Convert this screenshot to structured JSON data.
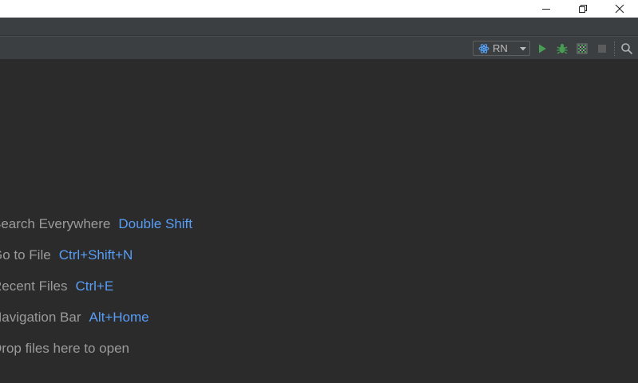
{
  "toolbar": {
    "run_config": {
      "label": "RN",
      "icon": "react-atom-icon"
    },
    "icons": {
      "run": "run-icon",
      "debug": "debug-icon",
      "coverage": "coverage-icon",
      "stop": "stop-icon",
      "search": "search-icon"
    },
    "colors": {
      "run": "#499c54",
      "debug": "#499c54",
      "stop_disabled": "#5c5c5c",
      "react": "#58a6ff"
    }
  },
  "window_controls": {
    "minimize": "minimize-icon",
    "maximize": "restore-icon",
    "close": "close-icon"
  },
  "editor": {
    "hints": [
      {
        "text": "Search Everywhere",
        "shortcut": "Double Shift"
      },
      {
        "text": "Go to File",
        "shortcut": "Ctrl+Shift+N"
      },
      {
        "text": "Recent Files",
        "shortcut": "Ctrl+E"
      },
      {
        "text": "Navigation Bar",
        "shortcut": "Alt+Home"
      },
      {
        "text": "Drop files here to open",
        "shortcut": ""
      }
    ],
    "colors": {
      "text": "#9b9b9b",
      "shortcut": "#589df6",
      "background": "#2b2b2b"
    }
  }
}
